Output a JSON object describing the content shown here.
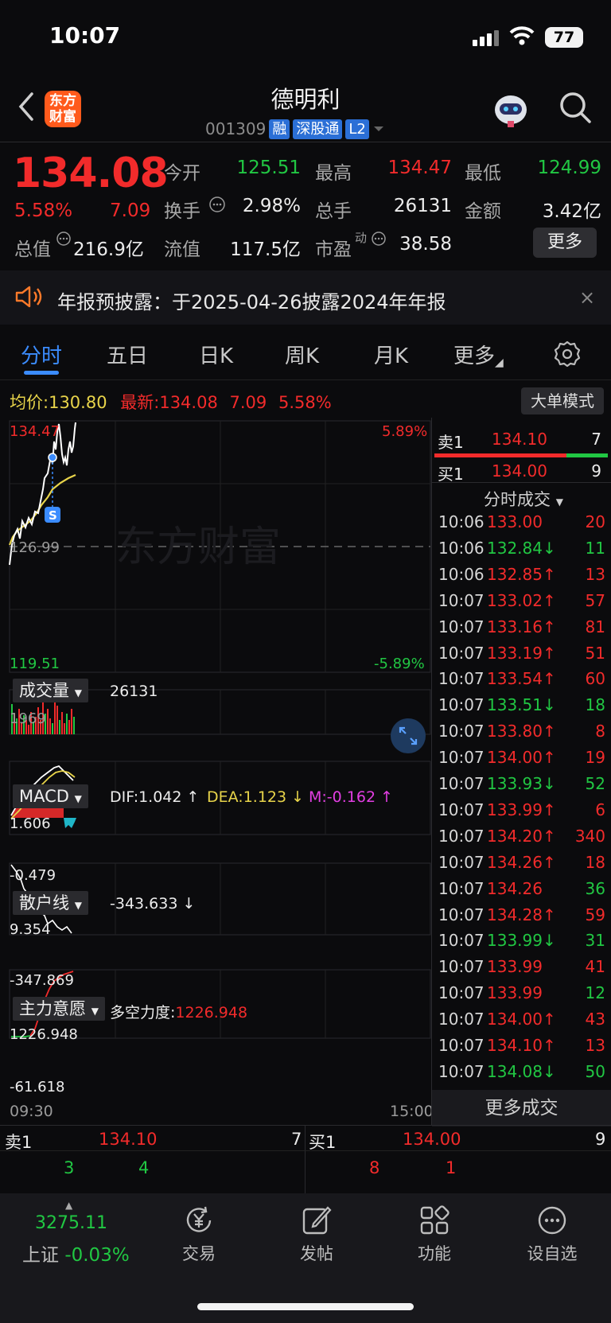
{
  "status_bar": {
    "time": "10:07",
    "battery": "77"
  },
  "header": {
    "logo_line1": "东方",
    "logo_line2": "财富",
    "stock_name": "德明利",
    "stock_code": "001309",
    "tags": [
      "融",
      "深股通",
      "L2"
    ]
  },
  "quote": {
    "price": "134.08",
    "change_pct": "5.58%",
    "change": "7.09",
    "fields": [
      {
        "label": "今开",
        "value": "125.51",
        "color": "green"
      },
      {
        "label": "最高",
        "value": "134.47",
        "color": "red"
      },
      {
        "label": "最低",
        "value": "124.99",
        "color": "green"
      },
      {
        "label": "换手",
        "value": "2.98%",
        "color": "white"
      },
      {
        "label": "总手",
        "value": "26131",
        "color": "white"
      },
      {
        "label": "金额",
        "value": "3.42亿",
        "color": "white"
      },
      {
        "label": "总值",
        "value": "216.9亿",
        "color": "white"
      },
      {
        "label": "流值",
        "value": "117.5亿",
        "color": "white"
      },
      {
        "label": "市盈",
        "value": "38.58",
        "color": "white"
      }
    ],
    "pe_superscript": "动",
    "more_label": "更多"
  },
  "notice": {
    "text": "年报预披露：于2025-04-26披露2024年年报",
    "close": "×"
  },
  "tabs": [
    "分时",
    "五日",
    "日K",
    "周K",
    "月K",
    "更多"
  ],
  "chart": {
    "avg_label": "均价:",
    "avg_value": "130.80",
    "latest_label": "最新:",
    "latest_value": "134.08",
    "latest_change": "7.09",
    "latest_pct": "5.58%",
    "bigorder_label": "大单模式",
    "price_high": "134.47",
    "price_pre": "126.99",
    "price_low": "119.51",
    "pct_high": "5.89%",
    "pct_low": "-5.89%",
    "watermark": "东方财富",
    "s_marker": "S",
    "time_start": "09:30",
    "time_end": "15:00",
    "volume_label": "成交量",
    "volume_value": "26131",
    "volume_max": "1969",
    "macd_label": "MACD",
    "macd_dif": "DIF:1.042 ↑",
    "macd_dea": "DEA:1.123 ↓",
    "macd_m": "M:-0.162 ↑",
    "macd_max": "1.606",
    "macd_min": "-0.479",
    "retail_label": "散户线",
    "retail_value": "-343.633 ↓",
    "retail_max": "9.354",
    "retail_min": "-347.869",
    "main_label": "主力意愿",
    "main_value_label": "多空力度:",
    "main_value": "1226.948",
    "main_max": "1226.948",
    "main_min": "-61.618"
  },
  "order_book_side": {
    "sell_label": "卖1",
    "sell_price": "134.10",
    "sell_vol": "7",
    "buy_label": "买1",
    "buy_price": "134.00",
    "buy_vol": "9",
    "ticks_title": "分时成交"
  },
  "ticks": [
    {
      "time": "10:06",
      "price": "133.00",
      "dir": "",
      "vol": "20",
      "vc": "red"
    },
    {
      "time": "10:06",
      "price": "132.84",
      "dir": "↓",
      "vol": "11",
      "vc": "green"
    },
    {
      "time": "10:06",
      "price": "132.85",
      "dir": "↑",
      "vol": "13",
      "vc": "red"
    },
    {
      "time": "10:07",
      "price": "133.02",
      "dir": "↑",
      "vol": "57",
      "vc": "red"
    },
    {
      "time": "10:07",
      "price": "133.16",
      "dir": "↑",
      "vol": "81",
      "vc": "red"
    },
    {
      "time": "10:07",
      "price": "133.19",
      "dir": "↑",
      "vol": "51",
      "vc": "red"
    },
    {
      "time": "10:07",
      "price": "133.54",
      "dir": "↑",
      "vol": "60",
      "vc": "red"
    },
    {
      "time": "10:07",
      "price": "133.51",
      "dir": "↓",
      "vol": "18",
      "vc": "green"
    },
    {
      "time": "10:07",
      "price": "133.80",
      "dir": "↑",
      "vol": "8",
      "vc": "red"
    },
    {
      "time": "10:07",
      "price": "134.00",
      "dir": "↑",
      "vol": "19",
      "vc": "red"
    },
    {
      "time": "10:07",
      "price": "133.93",
      "dir": "↓",
      "vol": "52",
      "vc": "green"
    },
    {
      "time": "10:07",
      "price": "133.99",
      "dir": "↑",
      "vol": "6",
      "vc": "red"
    },
    {
      "time": "10:07",
      "price": "134.20",
      "dir": "↑",
      "vol": "340",
      "vc": "red"
    },
    {
      "time": "10:07",
      "price": "134.26",
      "dir": "↑",
      "vol": "18",
      "vc": "red"
    },
    {
      "time": "10:07",
      "price": "134.26",
      "dir": "",
      "vol": "36",
      "vc": "green"
    },
    {
      "time": "10:07",
      "price": "134.28",
      "dir": "↑",
      "vol": "59",
      "vc": "red"
    },
    {
      "time": "10:07",
      "price": "133.99",
      "dir": "↓",
      "vol": "31",
      "vc": "green"
    },
    {
      "time": "10:07",
      "price": "133.99",
      "dir": "",
      "vol": "41",
      "vc": "red"
    },
    {
      "time": "10:07",
      "price": "133.99",
      "dir": "",
      "vol": "12",
      "vc": "green"
    },
    {
      "time": "10:07",
      "price": "134.00",
      "dir": "↑",
      "vol": "43",
      "vc": "red"
    },
    {
      "time": "10:07",
      "price": "134.10",
      "dir": "↑",
      "vol": "13",
      "vc": "red"
    },
    {
      "time": "10:07",
      "price": "134.08",
      "dir": "↓",
      "vol": "50",
      "vc": "green"
    }
  ],
  "more_ticks_label": "更多成交",
  "bottom_book": {
    "sell_label": "卖1",
    "sell_price": "134.10",
    "sell_vol": "7",
    "buy_label": "买1",
    "buy_price": "134.00",
    "buy_vol": "9",
    "sell_a": "3",
    "sell_b": "4",
    "buy_a": "8",
    "buy_b": "1"
  },
  "bottom_nav": {
    "index_value": "3275.11",
    "index_name": "上证",
    "index_change": "-0.03%",
    "items": [
      "交易",
      "发帖",
      "功能",
      "设自选"
    ]
  },
  "colors": {
    "up": "#f22b2b",
    "down": "#21c743",
    "accent": "#3b8cff",
    "avg": "#e8d44a"
  }
}
